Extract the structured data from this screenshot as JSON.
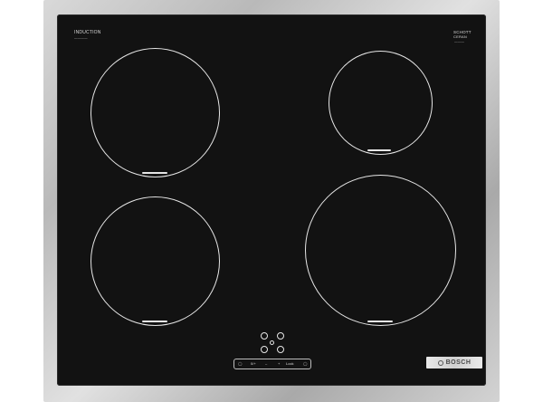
{
  "hob": {
    "type_label": "INDUCTION",
    "type_sublabel": "————",
    "glass_brand_line1": "SCHOTT",
    "glass_brand_line2": "CERAN",
    "glass_brand_sublabel": "———",
    "brand": "BOSCH"
  },
  "controls": {
    "item_1": "◯",
    "item_2": "0/+",
    "item_3": "–",
    "item_4": "+",
    "item_5": "Lock",
    "item_6": "◯"
  },
  "colors": {
    "glass": "#121212",
    "frame": "#c4c4c4",
    "markings": "#e6e6e6"
  },
  "icons": [
    "bosch-logo-icon",
    "power-icon",
    "timer-icon"
  ]
}
